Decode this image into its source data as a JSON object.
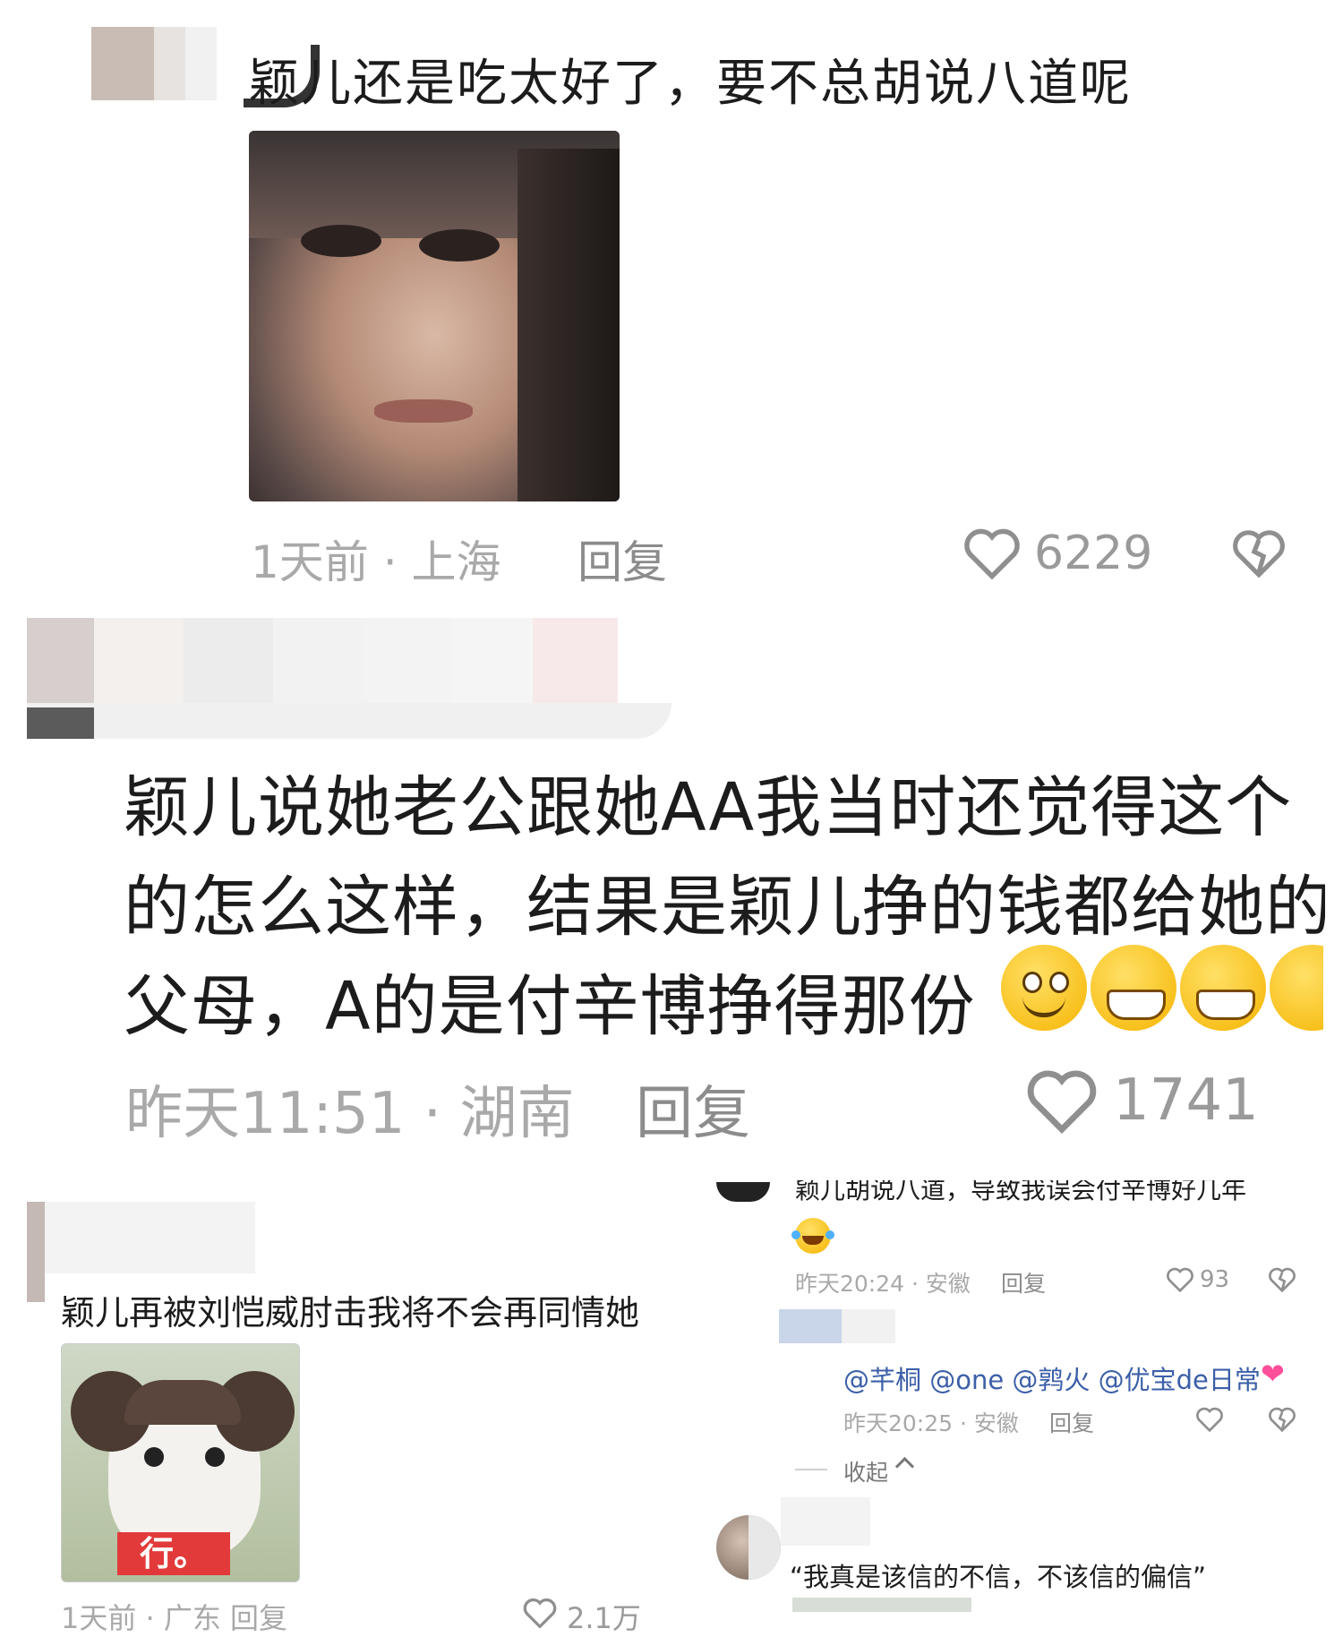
{
  "comment1": {
    "text": "颖儿还是吃太好了，要不总胡说八道呢",
    "time_loc": "1天前 · 上海",
    "reply": "回复",
    "likes": "6229"
  },
  "comment2": {
    "line1": "颖儿说她老公跟她AA我当时还觉得这个",
    "line2": "的怎么这样，结果是颖儿挣的钱都给她的",
    "line3": "父母，A的是付辛博挣得那份",
    "time_loc": "昨天11:51 · 湖南",
    "reply": "回复",
    "likes": "1741"
  },
  "comment3": {
    "text": "颖儿再被刘恺威肘击我将不会再同情她",
    "sticker_text": "行。",
    "footer_partial": "1天前 · 广东   回复",
    "likes_partial": "2.1万"
  },
  "thread": {
    "top_cut_text": "颖儿胡说八道，导致我误会付辛博好几年",
    "reply1_time": "昨天20:24 · 安徽",
    "reply1_reply": "回复",
    "reply1_likes": "93",
    "mentions": "@芊桐 @one @鹑火 @优宝de日常",
    "reply2_time": "昨天20:25 · 安徽",
    "reply2_reply": "回复",
    "collapse": "收起",
    "quote": "“我真是该信的不信，不该信的偏信”"
  }
}
